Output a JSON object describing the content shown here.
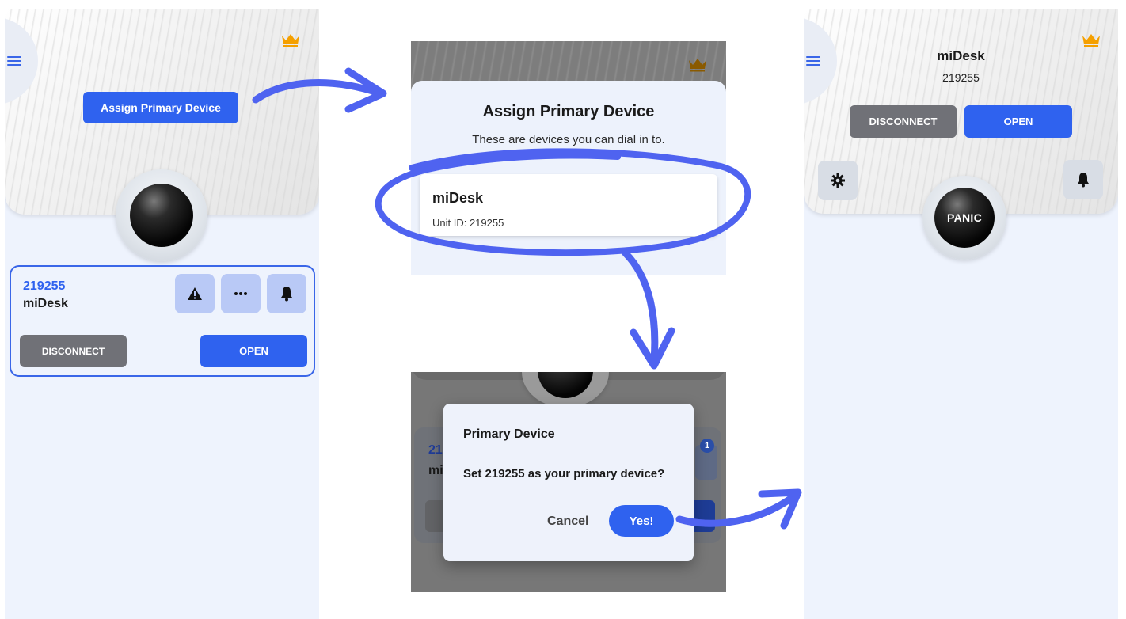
{
  "screen1": {
    "assign_button": "Assign Primary Device",
    "unit_card": {
      "unit_id": "219255",
      "unit_name": "miDesk",
      "disconnect_label": "DISCONNECT",
      "open_label": "OPEN"
    }
  },
  "assign_sheet": {
    "title": "Assign Primary Device",
    "subtitle": "These are devices you can dial in to.",
    "device": {
      "name": "miDesk",
      "unit_id_text": "Unit ID: 219255"
    }
  },
  "confirm_dialog": {
    "title": "Primary Device",
    "message": "Set 219255 as your primary device?",
    "cancel_label": "Cancel",
    "confirm_label": "Yes!",
    "background": {
      "partial_id": "21",
      "partial_name": "mi",
      "badge_count": "1"
    }
  },
  "screen4": {
    "device_name": "miDesk",
    "device_id": "219255",
    "disconnect_label": "DISCONNECT",
    "open_label": "OPEN",
    "panic_label": "PANIC"
  },
  "colors": {
    "accent": "#2f62ef",
    "gray_button": "#707177",
    "crown": "#f5a000",
    "annotation": "#4f63f0"
  }
}
